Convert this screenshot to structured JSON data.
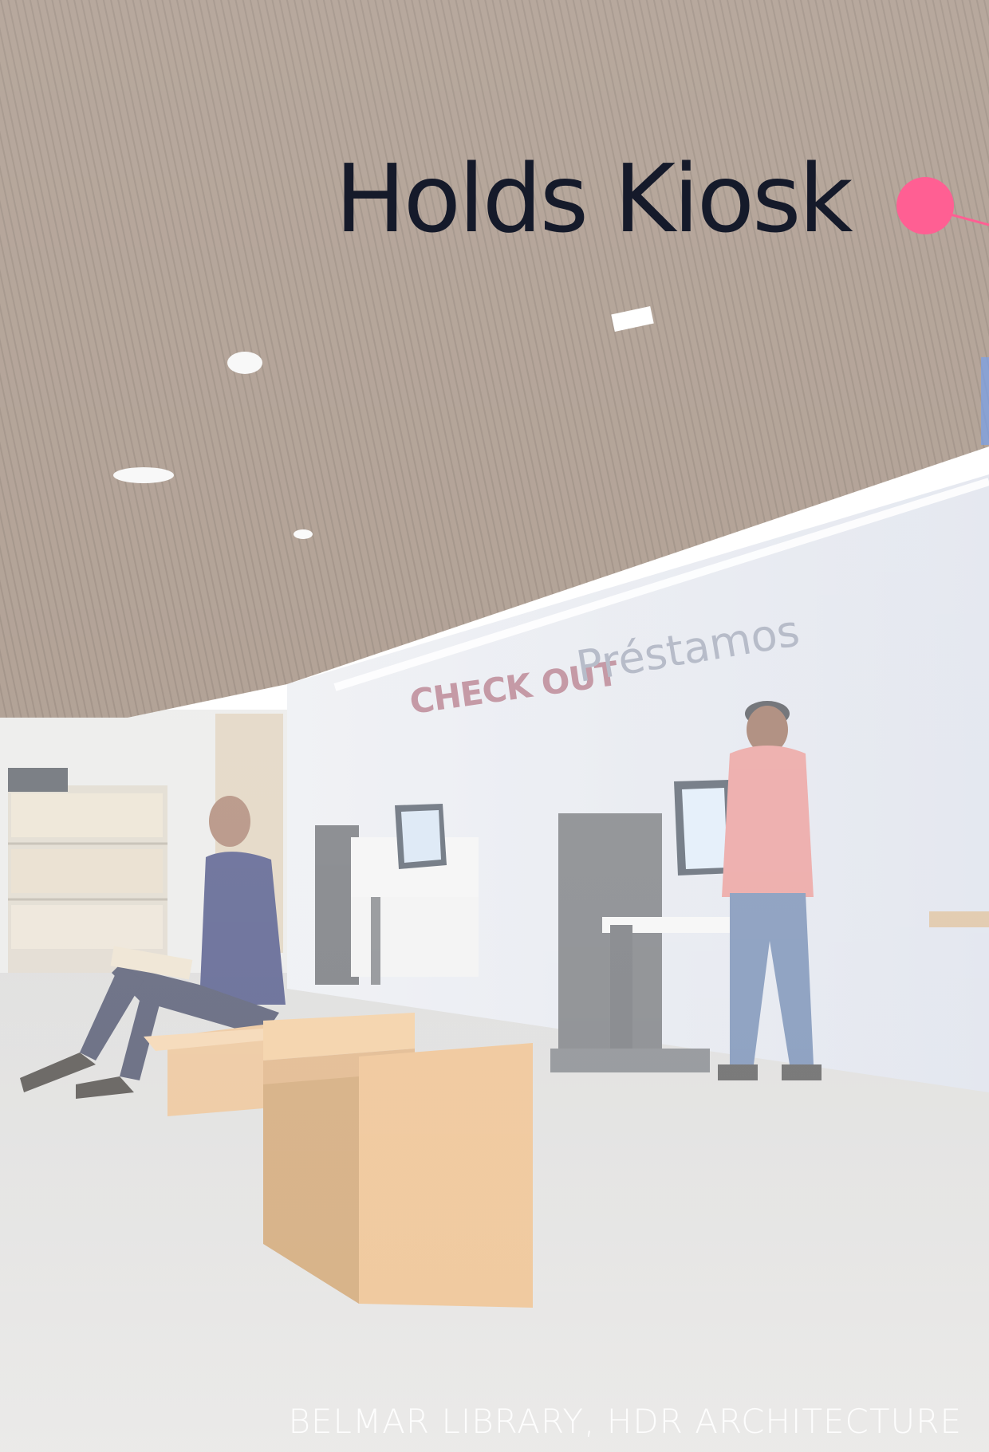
{
  "photo": {
    "title": "Holds Kiosk",
    "credit": "BELMAR LIBRARY, HDR ARCHITECTURE",
    "wall_sign_english": "CHECK OUT",
    "wall_sign_spanish": "Préstamos"
  },
  "colors": {
    "ceiling": "#8c7462",
    "wall": "#dfe3ec",
    "floor": "#d9d8d6",
    "bench": "#e6b27a",
    "accent_dot": "#ff5f93",
    "title_text": "#151a2a"
  },
  "icons": {
    "marker": "pink-dot-icon"
  }
}
